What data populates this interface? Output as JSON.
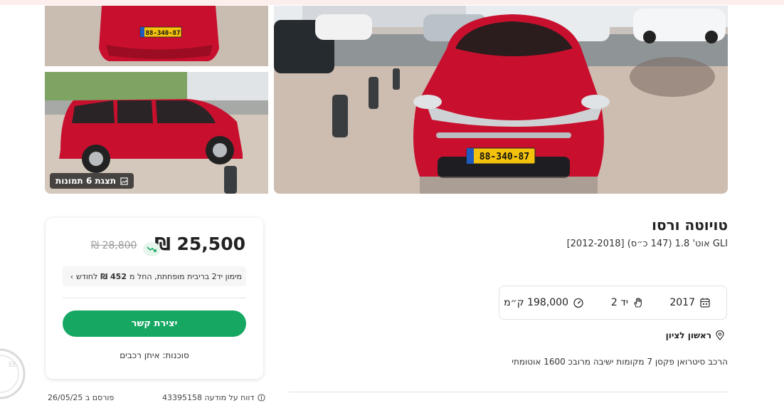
{
  "listing": {
    "title": "טויוטה ורסו",
    "subtitle": "GLI אוט' 1.8 (147 כ״ס) [2012-2018]",
    "description": "הרכב סיטרואן פקסן 7 מקומות ישיבה מרובכ 1600 אוטומתי",
    "location": "ראשון לציון",
    "specs": {
      "year": "2017",
      "hand": "יד 2",
      "km": "198,000 ק״מ"
    },
    "show_photos_label": "תצגת 6 תמונות",
    "plate_text": "88-340-87"
  },
  "price": {
    "current": "25,500 ₪",
    "previous": "28,800 ₪",
    "finance_pre": "מימון יד2 בריבית מופחתת, החל מ",
    "finance_amount": "452 ₪",
    "finance_post": "לחודש",
    "contact_button": "יצירת קשר",
    "agency": "סוכנות: איתן רכבים"
  },
  "meta": {
    "report": "דווח על מודעה 43395158",
    "published": "פורסם ב 26/05/25"
  },
  "icons": {
    "price_drop": "trend-down-icon",
    "year": "calendar-icon",
    "hand": "hand-icon",
    "km": "speedometer-icon",
    "location": "location-pin-icon",
    "gallery": "gallery-icon",
    "info": "info-icon"
  },
  "colors": {
    "car": "#c8102e",
    "accent": "#16a863",
    "drop_badge": "#e6f6ec"
  }
}
